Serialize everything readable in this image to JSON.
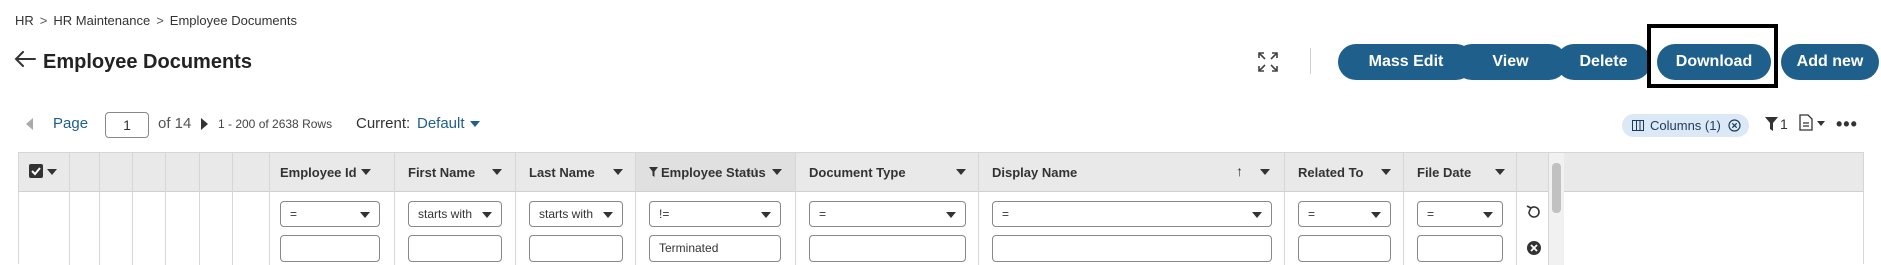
{
  "breadcrumb": {
    "items": [
      "HR",
      "HR Maintenance",
      "Employee Documents"
    ],
    "separator": ">"
  },
  "page": {
    "title": "Employee Documents"
  },
  "toolbar": {
    "mass_edit": "Mass Edit",
    "view": "View",
    "delete": "Delete",
    "download": "Download",
    "add_new": "Add new"
  },
  "pager": {
    "page_label": "Page",
    "page_value": "1",
    "of_total": "of 14",
    "rows": "1 - 200 of 2638 Rows",
    "current_label": "Current:",
    "current_value": "Default"
  },
  "columns_chip": {
    "label": "Columns (1)"
  },
  "filter_count": "1",
  "grid": {
    "columns": [
      {
        "label": "Employee Id",
        "operator": "=",
        "value": ""
      },
      {
        "label": "First Name",
        "operator": "starts with",
        "value": ""
      },
      {
        "label": "Last Name",
        "operator": "starts with",
        "value": ""
      },
      {
        "label": "Employee Status",
        "operator": "!=",
        "value": "Terminated"
      },
      {
        "label": "Document Type",
        "operator": "=",
        "value": ""
      },
      {
        "label": "Display Name",
        "operator": "=",
        "value": ""
      },
      {
        "label": "Related To",
        "operator": "=",
        "value": ""
      },
      {
        "label": "File Date",
        "operator": "=",
        "value": ""
      }
    ]
  },
  "colors": {
    "accent": "#1e5f8c",
    "link": "#1e5f8c",
    "chip_bg": "#dbe8f5"
  }
}
